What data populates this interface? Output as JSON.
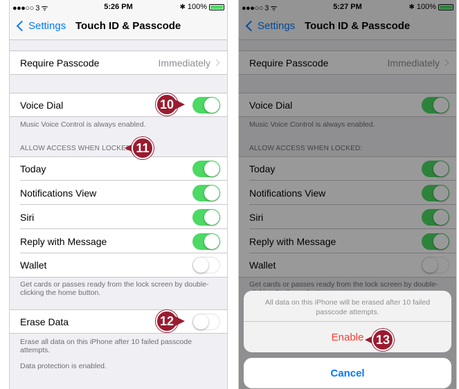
{
  "status_left": {
    "signal": "●●●○○ 3 ᯤ",
    "time": "5:26 PM",
    "battery": "100%"
  },
  "status_right": {
    "signal": "●●●○○ 3 ᯤ",
    "time": "5:27 PM",
    "battery": "100%"
  },
  "nav": {
    "back_label": "Settings",
    "title": "Touch ID & Passcode"
  },
  "require_passcode": {
    "label": "Require Passcode",
    "value": "Immediately"
  },
  "voice_dial": {
    "label": "Voice Dial",
    "footer": "Music Voice Control is always enabled.",
    "on": true
  },
  "locked_section": {
    "header": "ALLOW ACCESS WHEN LOCKED:",
    "items": [
      {
        "label": "Today",
        "on": true
      },
      {
        "label": "Notifications View",
        "on": true
      },
      {
        "label": "Siri",
        "on": true
      },
      {
        "label": "Reply with Message",
        "on": true
      },
      {
        "label": "Wallet",
        "on": false
      }
    ],
    "footer": "Get cards or passes ready from the lock screen by double-clicking the home button."
  },
  "erase_data": {
    "label": "Erase Data",
    "on": false,
    "footer": "Erase all data on this iPhone after 10 failed passcode attempts.",
    "footer2": "Data protection is enabled."
  },
  "action_sheet": {
    "message": "All data on this iPhone will be erased after 10 failed passcode attempts.",
    "enable_label": "Enable",
    "cancel_label": "Cancel"
  },
  "callouts": {
    "c10": "10",
    "c11": "11",
    "c12": "12",
    "c13": "13"
  },
  "colors": {
    "toggle_on": "#4cd964",
    "callout": "#9b1b2f",
    "ios_blue": "#007aff",
    "destructive": "#ff3b30"
  }
}
